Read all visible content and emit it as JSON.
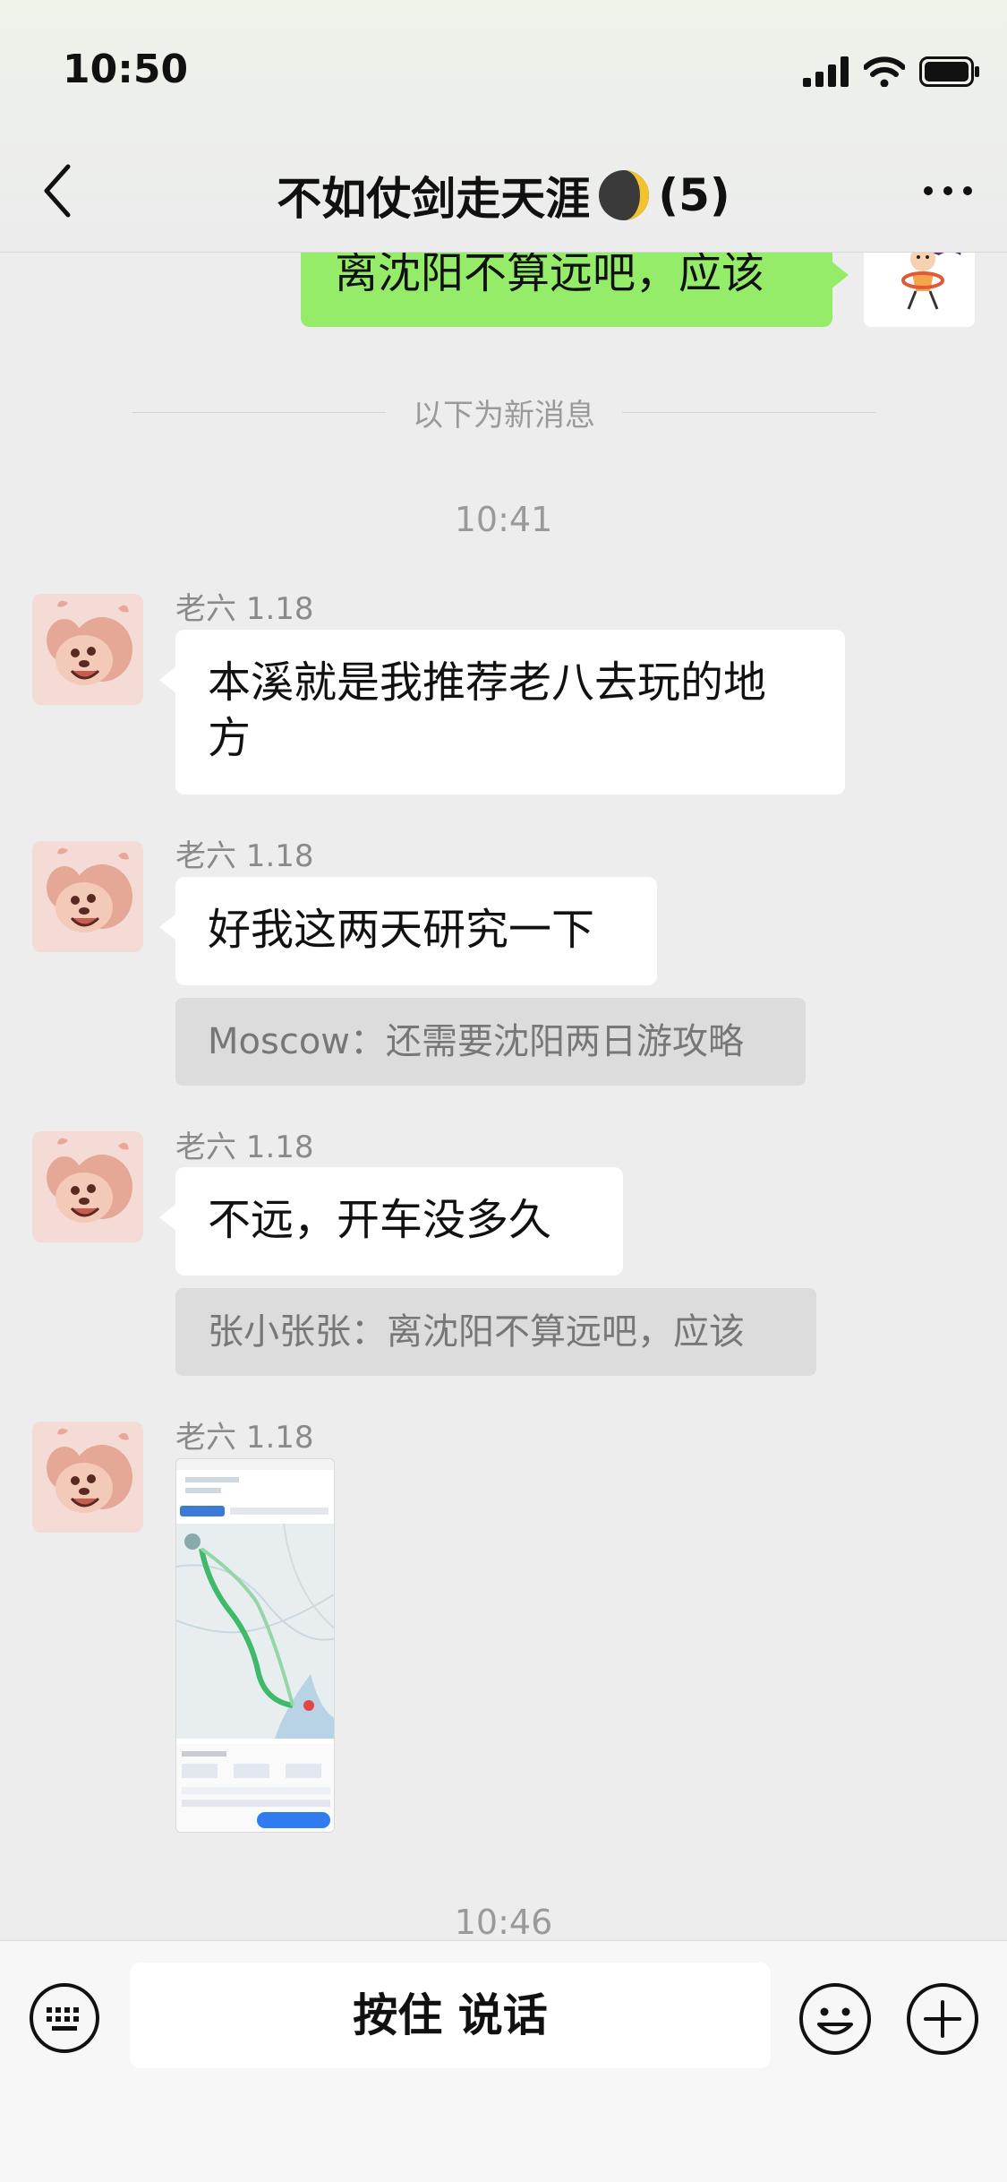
{
  "status_bar": {
    "time": "10:50"
  },
  "header": {
    "title": "不如仗剑走天涯",
    "member_count": "(5)"
  },
  "sent_message": {
    "text": "离沈阳不算远吧，应该"
  },
  "divider_text": "以下为新消息",
  "timestamps": [
    "10:41",
    "10:46"
  ],
  "messages": [
    {
      "sender": "老六 1.18",
      "text_lines": [
        "本溪就是我推荐老八去玩的地",
        "方"
      ]
    },
    {
      "sender": "老六 1.18",
      "text": "好我这两天研究一下",
      "quote": "Moscow：还需要沈阳两日游攻略"
    },
    {
      "sender": "老六 1.18",
      "text": "不远，开车没多久",
      "quote": "张小张张：离沈阳不算远吧，应该"
    },
    {
      "sender": "老六 1.18"
    }
  ],
  "input_bar": {
    "voice_label": "按住 说话"
  }
}
